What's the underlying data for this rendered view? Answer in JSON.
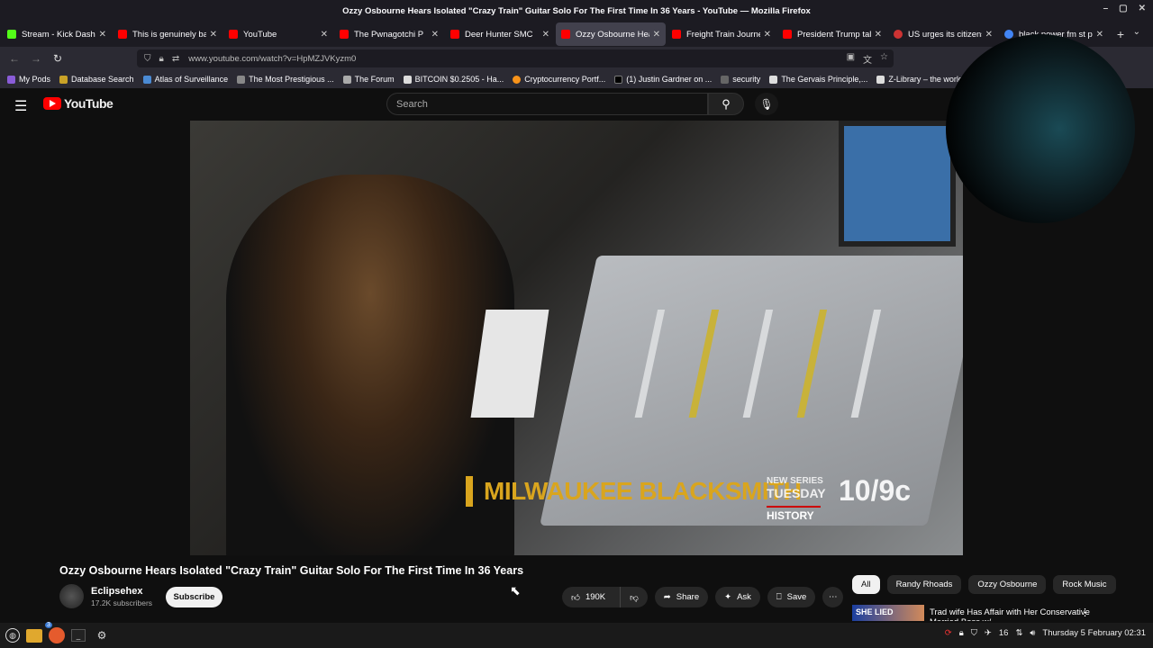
{
  "window": {
    "title": "Ozzy Osbourne Hears Isolated \"Crazy Train\" Guitar Solo For The First Time In 36 Years - YouTube — Mozilla Firefox"
  },
  "tabs": [
    {
      "label": "Stream - Kick Dashbo",
      "color": "#53fc18",
      "active": false
    },
    {
      "label": "This is genuinely bad",
      "color": "#ff0000",
      "active": false
    },
    {
      "label": "YouTube",
      "color": "#ff0000",
      "active": false
    },
    {
      "label": "The Pwnagotchi P",
      "color": "#ff0000",
      "active": false
    },
    {
      "label": "Deer Hunter SMC",
      "color": "#ff0000",
      "active": false
    },
    {
      "label": "Ozzy Osbourne Hear",
      "color": "#ff0000",
      "active": true
    },
    {
      "label": "Freight Train Journe",
      "color": "#ff0000",
      "active": false
    },
    {
      "label": "President Trump talk",
      "color": "#ff0000",
      "active": false
    },
    {
      "label": "US urges its citizens",
      "color": "#cc3333",
      "active": false
    },
    {
      "label": "black power fm st pe",
      "color": "#4285f4",
      "active": false
    }
  ],
  "nav": {
    "url": "www.youtube.com/watch?v=HpMZJVKyzm0"
  },
  "bookmarks": [
    {
      "label": "My Pods",
      "color": "#8a5cd8"
    },
    {
      "label": "Database Search",
      "color": "#c9a227"
    },
    {
      "label": "Atlas of Surveillance",
      "color": "#4b8bd4"
    },
    {
      "label": "The Most Prestigious ...",
      "color": "#888888"
    },
    {
      "label": "The Forum",
      "color": "#aaaaaa"
    },
    {
      "label": "BITCOIN $0.2505 - Ha...",
      "color": "#dddddd"
    },
    {
      "label": "Cryptocurrency Portf...",
      "color": "#f7931a"
    },
    {
      "label": "(1) Justin Gardner on ...",
      "color": "#000000"
    },
    {
      "label": "security",
      "color": "#666666"
    },
    {
      "label": "The Gervais Principle,...",
      "color": "#dddddd"
    },
    {
      "label": "Z-Library – the world'...",
      "color": "#dddddd"
    }
  ],
  "youtube": {
    "logo_text": "YouTube",
    "search_placeholder": "Search"
  },
  "video": {
    "overlay_brand": "MILWAUKEE BLACKSMITH",
    "overlay_when": "NEW SERIES",
    "overlay_day": "TUESDAY",
    "overlay_time": "10/9c",
    "overlay_network": "HISTORY",
    "title": "Ozzy Osbourne Hears Isolated \"Crazy Train\" Guitar Solo For The First Time In 36 Years",
    "channel": "Eclipsehex",
    "subscribers": "17.2K subscribers",
    "subscribe_label": "Subscribe",
    "likes": "190K",
    "share_label": "Share",
    "ask_label": "Ask",
    "save_label": "Save"
  },
  "chips": [
    "All",
    "Randy Rhoads",
    "Ozzy Osbourne",
    "Rock Music"
  ],
  "recommendation": {
    "thumb_text": "SHE LIED",
    "title": "Trad wife Has Affair with Her Conservative Married Boss w/..."
  },
  "taskbar": {
    "badge": "3",
    "clock": "Thursday  5 February 02:31",
    "volume_level": "16"
  }
}
